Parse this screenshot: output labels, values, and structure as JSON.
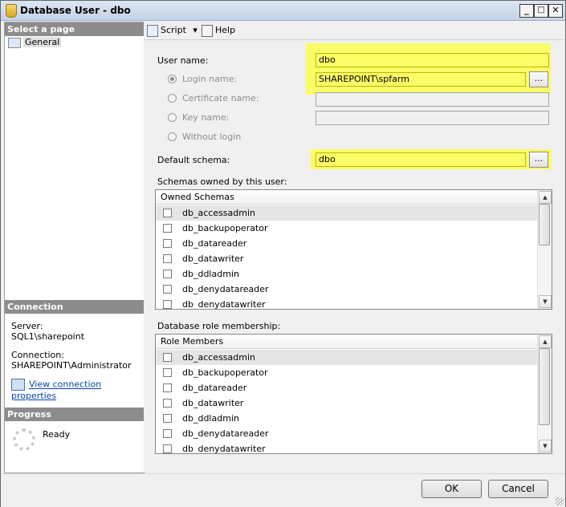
{
  "window": {
    "title": "Database User - dbo",
    "min_glyph": "_",
    "max_glyph": "□",
    "close_glyph": "✕"
  },
  "sidebar": {
    "select_page_header": "Select a page",
    "pages": [
      {
        "label": "General"
      }
    ],
    "connection_header": "Connection",
    "server_label": "Server:",
    "server_value": "SQL1\\sharepoint",
    "connection_label": "Connection:",
    "connection_value": "SHAREPOINT\\Administrator",
    "view_connection_link": "View connection properties",
    "progress_header": "Progress",
    "progress_status": "Ready"
  },
  "toolbar": {
    "script_label": "Script",
    "script_arrow": "▾",
    "help_label": "Help"
  },
  "form": {
    "user_name_label": "User name:",
    "user_name_value": "dbo",
    "login_name_label": "Login name:",
    "login_name_value": "SHAREPOINT\\spfarm",
    "certificate_name_label": "Certificate name:",
    "key_name_label": "Key name:",
    "without_login_label": "Without login",
    "browse_label": "...",
    "default_schema_label": "Default schema:",
    "default_schema_value": "dbo",
    "schemas_owned_label": "Schemas owned by this user:",
    "owned_schemas_header": "Owned Schemas",
    "owned_schemas": [
      "db_accessadmin",
      "db_backupoperator",
      "db_datareader",
      "db_datawriter",
      "db_ddladmin",
      "db_denydatareader",
      "db_denydatawriter"
    ],
    "role_membership_label": "Database role membership:",
    "role_members_header": "Role Members",
    "role_members": [
      "db_accessadmin",
      "db_backupoperator",
      "db_datareader",
      "db_datawriter",
      "db_ddladmin",
      "db_denydatareader",
      "db_denydatawriter"
    ],
    "scroll_up_glyph": "▲",
    "scroll_down_glyph": "▼"
  },
  "buttons": {
    "ok_label": "OK",
    "cancel_label": "Cancel"
  },
  "colors": {
    "highlight": "#ffff33",
    "section_header": "#8c8c8c",
    "link": "#0645ad"
  },
  "icons": {
    "title": "database-user-icon",
    "page": "general-page-icon",
    "script": "script-icon",
    "help": "help-icon",
    "connection": "connection-properties-icon",
    "progress": "progress-spinner-icon"
  }
}
